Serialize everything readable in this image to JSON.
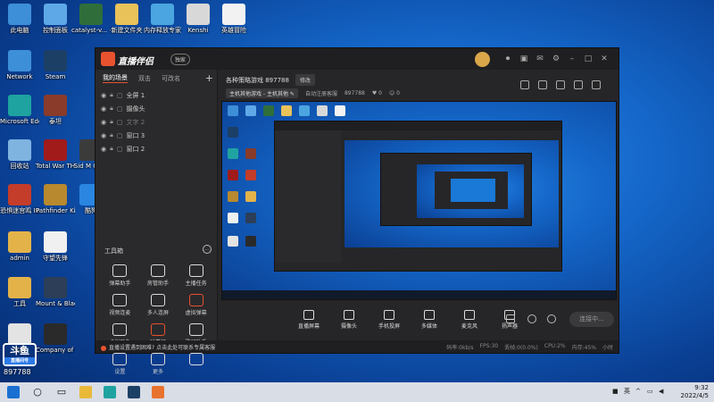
{
  "desktop_icons": [
    {
      "label": "此电脑",
      "color": "#3d8fd8"
    },
    {
      "label": "控制面板",
      "color": "#5fa8e8"
    },
    {
      "label": "catalyst-v... -绿色方式",
      "color": "#2f6e3a"
    },
    {
      "label": "新建文件夹",
      "color": "#e9c25a"
    },
    {
      "label": "内存释放专家",
      "color": "#4aa5e0"
    },
    {
      "label": "Kenshi",
      "color": "#d8d8d8"
    },
    {
      "label": "英雄冒险",
      "color": "#f2f2f2"
    },
    {
      "label": "Network",
      "color": "#3d8fd8"
    },
    {
      "label": "Steam",
      "color": "#1c3f66"
    },
    {
      "label": "Microsoft Edge",
      "color": "#1fa3a0"
    },
    {
      "label": "泰坦",
      "color": "#8a3b2a"
    },
    {
      "label": "回收站",
      "color": "#7fb3e0"
    },
    {
      "label": "Total War THREE KI...",
      "color": "#a11b1b"
    },
    {
      "label": "Sid M Civili",
      "color": "#3b3b3b"
    },
    {
      "label": "恐惧迷宫鸣 III",
      "color": "#c43c2a"
    },
    {
      "label": "Pathfinder Kingmaker",
      "color": "#b8892e"
    },
    {
      "label": "酷狗",
      "color": "#2a86e0"
    },
    {
      "label": "admin",
      "color": "#e3b34a"
    },
    {
      "label": "守望先锋",
      "color": "#f0f0f0"
    },
    {
      "label": "工具",
      "color": "#e3b34a"
    },
    {
      "label": "Mount & Blade II...",
      "color": "#2c3e58"
    },
    {
      "label": "文档",
      "color": "#e3e3e3"
    },
    {
      "label": "Company of Heroes 2",
      "color": "#2a2a2a"
    }
  ],
  "app": {
    "name": "直播伴侣",
    "badge": "独家"
  },
  "titlebar_icons": [
    "record-icon",
    "gift-icon",
    "mail-icon",
    "settings-icon",
    "minimize-icon",
    "maximize-icon",
    "close-icon"
  ],
  "sidebar": {
    "tabs": [
      "我的场景",
      "双击",
      "可改名"
    ],
    "add": "+",
    "scenes": [
      {
        "label": "全屏 1",
        "dim": false
      },
      {
        "label": "摄像头",
        "dim": false
      },
      {
        "label": "文字 2",
        "dim": true
      },
      {
        "label": "窗口 3",
        "dim": false
      },
      {
        "label": "窗口 2",
        "dim": false
      }
    ],
    "tools_title": "工具箱",
    "tools_more": "…",
    "tools": [
      {
        "label": "弹幕助手",
        "red": false
      },
      {
        "label": "房管助手",
        "red": false
      },
      {
        "label": "主播任务",
        "red": false
      },
      {
        "label": "视频连麦",
        "red": false
      },
      {
        "label": "多人连屏",
        "red": false
      },
      {
        "label": "虚拟弹幕",
        "red": true
      },
      {
        "label": "虚拟形象",
        "red": false
      },
      {
        "label": "弹幕姬",
        "red": true
      },
      {
        "label": "歌词助手",
        "red": false
      },
      {
        "label": "设置",
        "red": false
      },
      {
        "label": "更多",
        "red": false
      },
      {
        "label": "",
        "red": false
      }
    ]
  },
  "stream": {
    "title": "各种策略游戏 897788",
    "edit": "修改",
    "category": "主机其他游戏 - 主机其他",
    "edit_icon": "✎",
    "setup": "自动注册客服",
    "room_id": "897788",
    "likes": "0",
    "viewers": "0"
  },
  "controls": [
    {
      "label": "直播屏幕"
    },
    {
      "label": "摄像头"
    },
    {
      "label": "手机投屏"
    },
    {
      "label": "多媒体"
    },
    {
      "label": "麦克风"
    },
    {
      "label": "扬声器"
    }
  ],
  "go_live": "连接中...",
  "notice": "直播设置遇到困难? 点击此处可联系专属客服",
  "stats": [
    "码率:0kb/s",
    "FPS:30",
    "丢帧:0(0.0%)",
    "CPU:2%",
    "内存:45%",
    "小时"
  ],
  "overlay": {
    "logo": "斗鱼",
    "sub": "直播间号",
    "num": "897788"
  },
  "taskbar": {
    "time": "9:32",
    "date": "2022/4/5",
    "ime": "英",
    "apps": [
      "windows-logo-icon",
      "search-icon",
      "task-view-icon",
      "file-explorer-icon",
      "edge-icon",
      "steam-icon",
      "douyu-icon"
    ]
  }
}
